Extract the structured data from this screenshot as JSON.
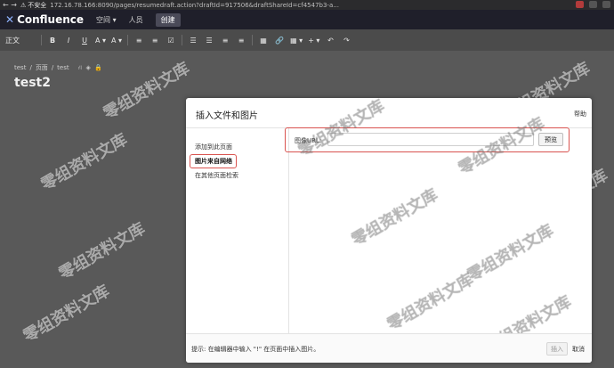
{
  "browser": {
    "nav": "← →",
    "security": "不安全",
    "url": "172.16.78.166:8090/pages/resumedraft.action?draftId=917506&draftShareId=cf4547b3-a..."
  },
  "header": {
    "logo_mark": "✕",
    "logo_text": "Confluence",
    "spaces": "空间 ▾",
    "people": "人员",
    "create": "创建"
  },
  "toolbar": {
    "style": "正文",
    "items": [
      "B",
      "I",
      "U",
      "A ▾",
      "A ▾",
      "≡",
      "≡",
      "☑",
      "☰",
      "☰",
      "≡",
      "≡",
      "▦",
      "🔗",
      "▦ ▾",
      "+ ▾",
      "↶",
      "↷"
    ]
  },
  "page": {
    "breadcrumb": [
      "test",
      "/",
      "页面",
      "/",
      "test"
    ],
    "title": "test2"
  },
  "dialog": {
    "title": "插入文件和图片",
    "help": "帮助",
    "side_items": [
      "添加到此页面",
      "图片来自网络",
      "在其他页面检索"
    ],
    "url_label": "图像URL:",
    "url_value": "",
    "preview": "预览",
    "tip": "提示: 在编辑器中输入 \"!\" 在页面中插入图片。",
    "insert": "插入",
    "cancel": "取消"
  },
  "watermark": "零组资料文库"
}
